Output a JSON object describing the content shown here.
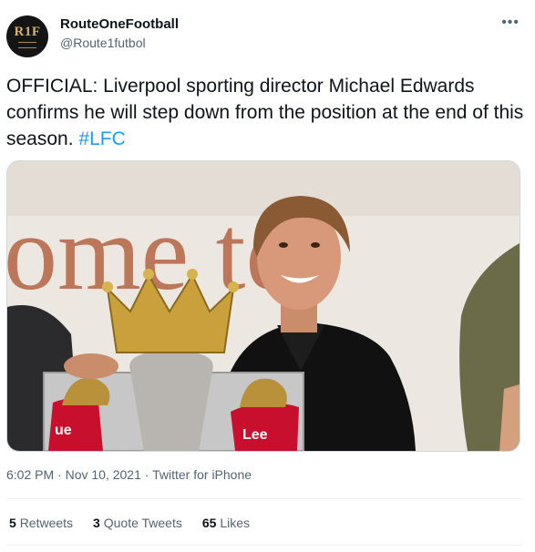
{
  "user": {
    "avatar_text": "R1F",
    "display_name": "RouteOneFootball",
    "handle": "@Route1futbol"
  },
  "tweet": {
    "text": "OFFICIAL: Liverpool sporting director Michael Edwards confirms he will step down from the position at the end of this season.",
    "hashtag": "#LFC"
  },
  "media": {
    "wall_text": "ome to",
    "banner_left": "ue",
    "banner_right": "Lee"
  },
  "meta": {
    "time": "6:02 PM",
    "sep1": "·",
    "date": "Nov 10, 2021",
    "sep2": "·",
    "source": "Twitter for iPhone"
  },
  "stats": {
    "retweets_count": "5",
    "retweets_label": "Retweets",
    "quotes_count": "3",
    "quotes_label": "Quote Tweets",
    "likes_count": "65",
    "likes_label": "Likes"
  },
  "icons": {
    "more": "more-horizontal-icon"
  },
  "colors": {
    "link": "#1d9bf0",
    "secondary": "#536471",
    "text": "#0f1419"
  }
}
